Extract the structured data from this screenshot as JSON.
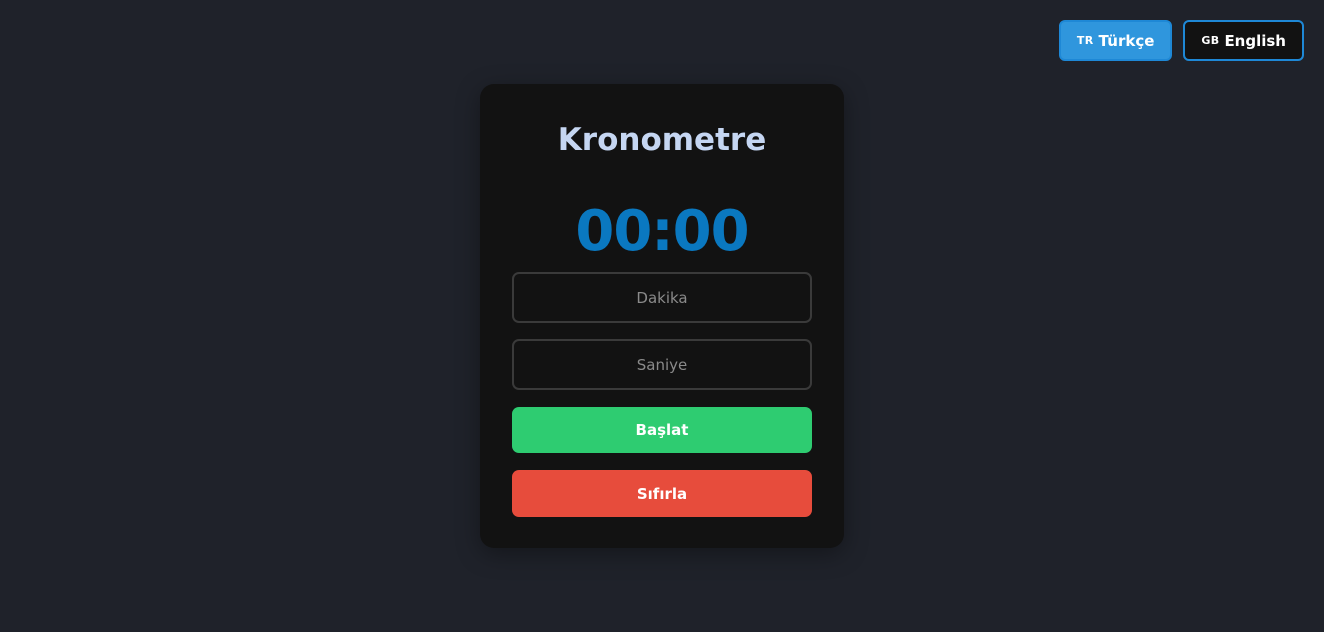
{
  "languages": {
    "turkish": {
      "flag": "TR",
      "label": "Türkçe",
      "active": true
    },
    "english": {
      "flag": "GB",
      "label": "English",
      "active": false
    }
  },
  "stopwatch": {
    "title": "Kronometre",
    "display": "00:00",
    "minutes_placeholder": "Dakika",
    "seconds_placeholder": "Saniye",
    "start_label": "Başlat",
    "reset_label": "Sıfırla"
  },
  "colors": {
    "background": "#1f222a",
    "card": "#121212",
    "accent_blue": "#0a78c0",
    "start_green": "#2ecc71",
    "reset_red": "#e74c3c"
  }
}
